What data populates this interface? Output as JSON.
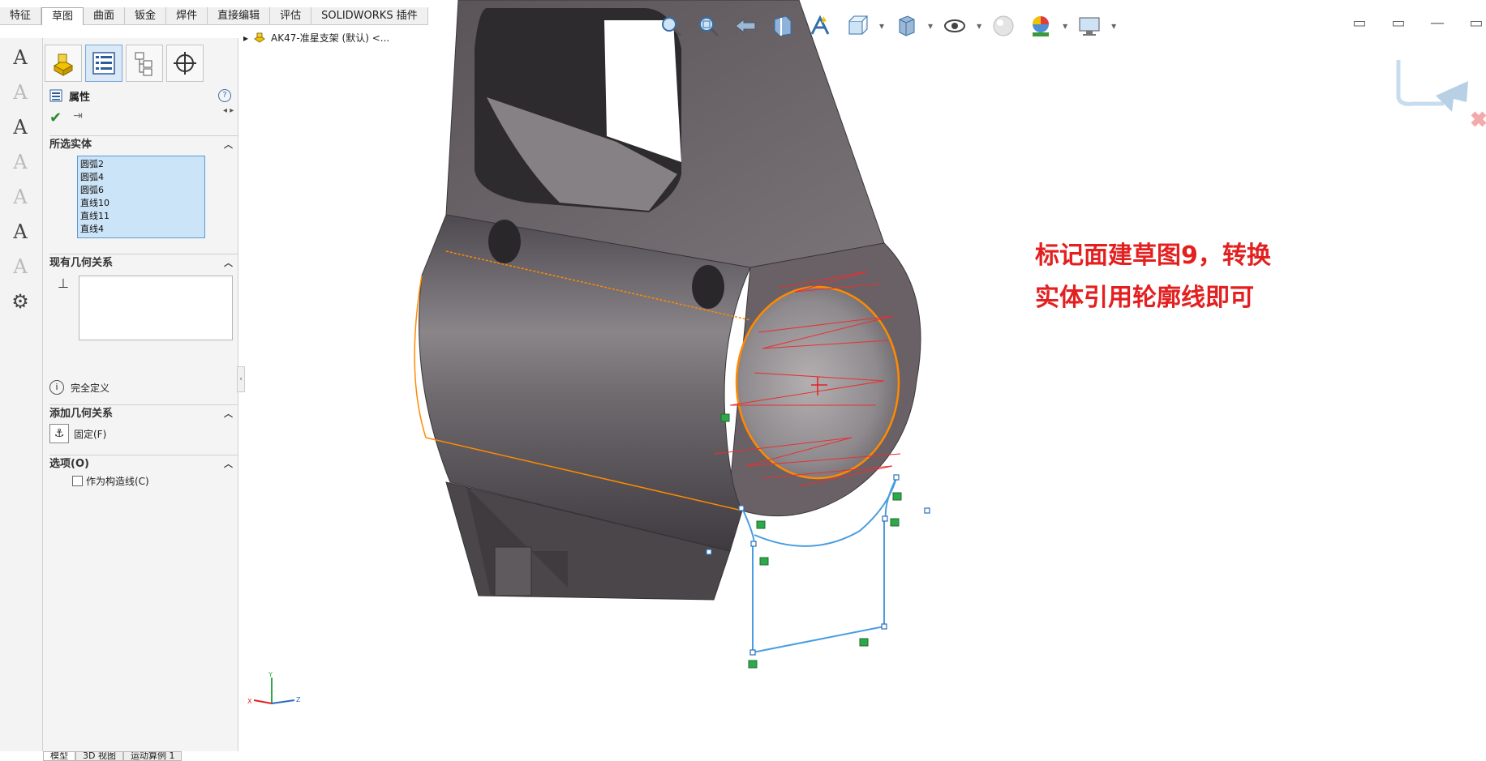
{
  "tabs": [
    "特征",
    "草图",
    "曲面",
    "钣金",
    "焊件",
    "直接编辑",
    "评估",
    "SOLIDWORKS 插件"
  ],
  "active_tab": 1,
  "left_tools": [
    {
      "icon": "smart-dimension-icon",
      "glyph": "A"
    },
    {
      "icon": "edit-text-icon",
      "glyph": "A"
    },
    {
      "icon": "convert-entities-icon",
      "glyph": "A"
    },
    {
      "icon": "offset-entities-icon",
      "glyph": "A"
    },
    {
      "icon": "mirror-entities-icon",
      "glyph": "A"
    },
    {
      "icon": "save-sketch-icon",
      "glyph": "A"
    },
    {
      "icon": "pattern-icon",
      "glyph": "A"
    },
    {
      "icon": "relations-icon",
      "glyph": "⚙"
    }
  ],
  "property_manager": {
    "title": "属性",
    "help": "?",
    "selected_entities": {
      "heading": "所选实体",
      "items": [
        "圆弧2",
        "圆弧4",
        "圆弧6",
        "直线10",
        "直线11",
        "直线4"
      ]
    },
    "existing_relations": {
      "heading": "现有几何关系",
      "status": "完全定义"
    },
    "add_relations": {
      "heading": "添加几何关系",
      "fix_label": "固定(F)"
    },
    "options": {
      "heading": "选项(O)",
      "construction_label": "作为构造线(C)"
    }
  },
  "tree": {
    "label": "AK47-准星支架 (默认) <..."
  },
  "annotation": {
    "line1": "标记面建草图9，转换",
    "line2": "实体引用轮廓线即可"
  },
  "bottom_tabs": [
    "模型",
    "3D 视图",
    "运动算例 1"
  ],
  "colors": {
    "accent_red": "#e32020",
    "sketch_blue": "#4a9de0",
    "edge_orange": "#ff8a00",
    "relation_green": "#2ea84a",
    "part_dark": "#5e5a5e"
  }
}
